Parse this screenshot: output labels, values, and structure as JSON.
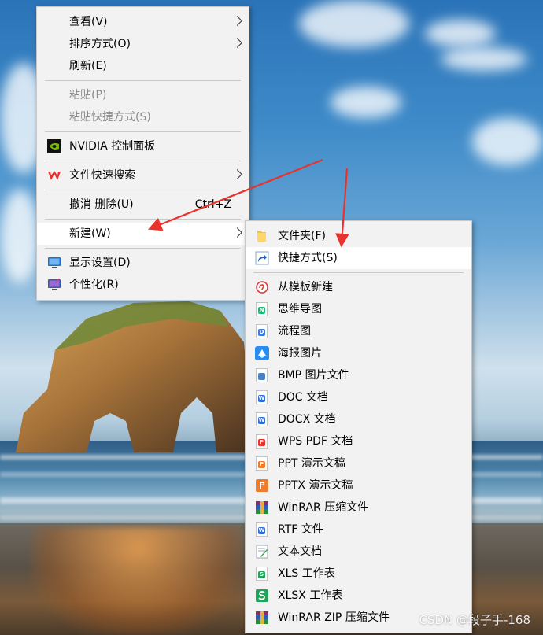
{
  "context_menu": {
    "items": [
      {
        "label": "查看(V)"
      },
      {
        "label": "排序方式(O)"
      },
      {
        "label": "刷新(E)"
      },
      {
        "label": "粘贴(P)"
      },
      {
        "label": "粘贴快捷方式(S)"
      },
      {
        "label": "NVIDIA 控制面板"
      },
      {
        "label": "文件快速搜索"
      },
      {
        "label": "撤消 删除(U)",
        "shortcut": "Ctrl+Z"
      },
      {
        "label": "新建(W)"
      },
      {
        "label": "显示设置(D)"
      },
      {
        "label": "个性化(R)"
      }
    ]
  },
  "new_submenu": {
    "items": [
      {
        "label": "文件夹(F)"
      },
      {
        "label": "快捷方式(S)"
      },
      {
        "label": "从模板新建"
      },
      {
        "label": "思维导图"
      },
      {
        "label": "流程图"
      },
      {
        "label": "海报图片"
      },
      {
        "label": "BMP 图片文件"
      },
      {
        "label": "DOC 文档"
      },
      {
        "label": "DOCX 文档"
      },
      {
        "label": "WPS PDF 文档"
      },
      {
        "label": "PPT 演示文稿"
      },
      {
        "label": "PPTX 演示文稿"
      },
      {
        "label": "WinRAR 压缩文件"
      },
      {
        "label": "RTF 文件"
      },
      {
        "label": "文本文档"
      },
      {
        "label": "XLS 工作表"
      },
      {
        "label": "XLSX 工作表"
      },
      {
        "label": "WinRAR ZIP 压缩文件"
      }
    ]
  },
  "watermark": "CSDN @段子手-168",
  "colors": {
    "menu_bg": "#f2f2f2",
    "highlight": "#ffffff",
    "disabled_text": "#8a8a8a",
    "annotation_arrow": "#e8322b"
  }
}
